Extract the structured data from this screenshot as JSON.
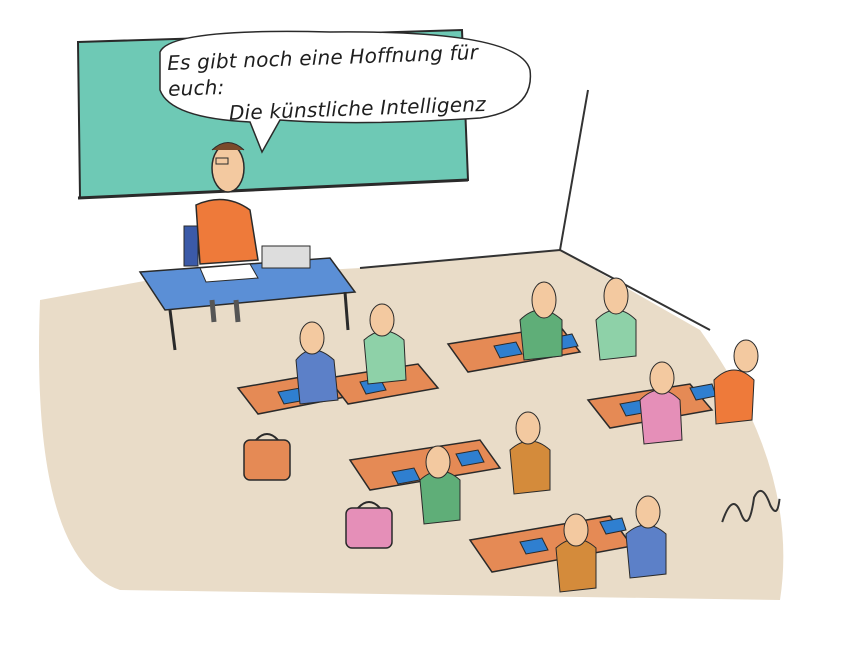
{
  "cartoon": {
    "speech_line_1": "Es gibt noch eine Hoffnung für euch:",
    "speech_line_2": "Die künstliche Intelligenz"
  },
  "colors": {
    "chalkboard": "#6ec9b5",
    "floor": "#e9dcc8",
    "desk_top": "#e58a55",
    "teacher_desk": "#5b8fd6",
    "teacher_shirt": "#ee7a3a",
    "tablet": "#2f7fd0"
  }
}
